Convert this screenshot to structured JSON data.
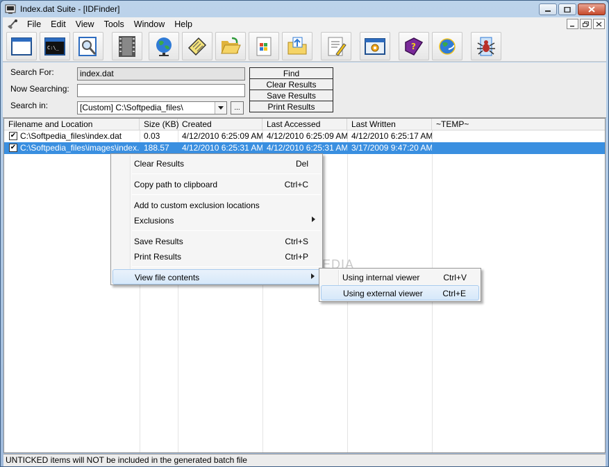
{
  "window": {
    "title": "Index.dat Suite - [IDFinder]"
  },
  "menubar": {
    "items": [
      "File",
      "Edit",
      "View",
      "Tools",
      "Window",
      "Help"
    ]
  },
  "toolbar": {
    "buttons": [
      "blank-window-icon",
      "command-prompt-icon",
      "search-document-icon",
      "film-strip-icon",
      "globe-icon",
      "notepad-icon",
      "open-folder-icon",
      "windows-document-icon",
      "folder-upload-icon",
      "edit-list-icon",
      "settings-window-icon",
      "help-book-icon",
      "internet-explorer-icon",
      "spider-icon"
    ]
  },
  "search": {
    "search_for_label": "Search For:",
    "search_for_value": "index.dat",
    "now_searching_label": "Now Searching:",
    "now_searching_value": "",
    "search_in_label": "Search in:",
    "search_in_value": "[Custom] C:\\Softpedia_files\\",
    "browse_label": "...",
    "find_label": "Find",
    "clear_label": "Clear Results",
    "save_label": "Save Results",
    "print_label": "Print Results"
  },
  "table": {
    "columns": [
      "Filename and Location",
      "Size (KB)",
      "Created",
      "Last Accessed",
      "Last Written",
      "~TEMP~"
    ],
    "rows": [
      {
        "checked": true,
        "cells": [
          "C:\\Softpedia_files\\index.dat",
          "0.03",
          "4/12/2010 6:25:09 AM",
          "4/12/2010 6:25:09 AM",
          "4/12/2010 6:25:17 AM",
          ""
        ]
      },
      {
        "checked": true,
        "cells": [
          "C:\\Softpedia_files\\images\\index.dat",
          "188.57",
          "4/12/2010 6:25:31 AM",
          "4/12/2010 6:25:31 AM",
          "3/17/2009 9:47:20 AM",
          ""
        ]
      }
    ]
  },
  "context_menu": {
    "clear": {
      "label": "Clear Results",
      "key": "Del"
    },
    "copy": {
      "label": "Copy path to clipboard",
      "key": "Ctrl+C"
    },
    "add_exclusion": {
      "label": "Add to custom exclusion locations"
    },
    "exclusions": {
      "label": "Exclusions"
    },
    "save": {
      "label": "Save Results",
      "key": "Ctrl+S"
    },
    "print": {
      "label": "Print Results",
      "key": "Ctrl+P"
    },
    "view": {
      "label": "View file contents"
    }
  },
  "submenu": {
    "internal": {
      "label": "Using internal viewer",
      "key": "Ctrl+V"
    },
    "external": {
      "label": "Using external viewer",
      "key": "Ctrl+E"
    }
  },
  "watermark": "SOFTPEDIA",
  "status": "UNTICKED items will NOT be included in the generated batch file",
  "check_glyph": "✔"
}
